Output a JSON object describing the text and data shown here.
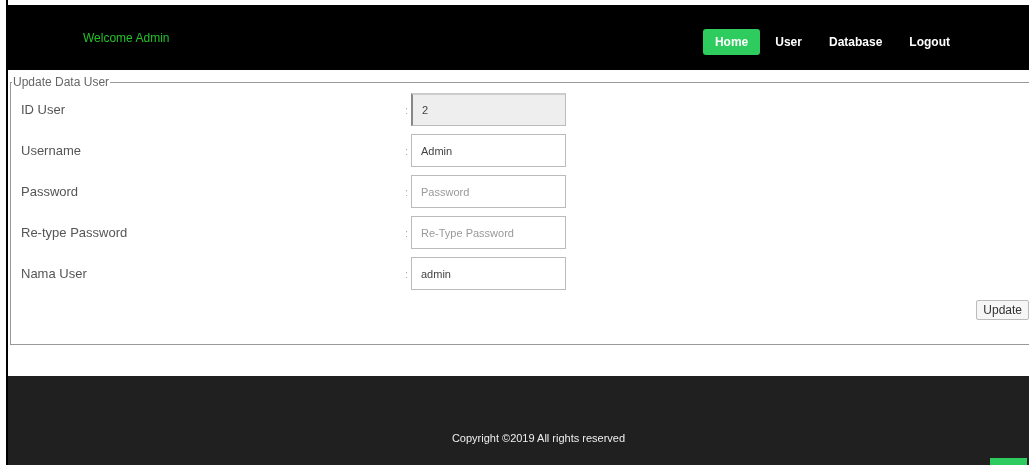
{
  "header": {
    "welcome": "Welcome Admin",
    "nav": [
      {
        "label": "Home",
        "selected": true
      },
      {
        "label": "User",
        "selected": false
      },
      {
        "label": "Database",
        "selected": false
      },
      {
        "label": "Logout",
        "selected": false
      }
    ]
  },
  "form": {
    "legend": "Update Data User",
    "fields": [
      {
        "label": "ID User",
        "separator": ":",
        "value": "2",
        "disabled": true
      },
      {
        "label": "Username",
        "separator": ":",
        "value": "Admin",
        "disabled": false
      },
      {
        "label": "Password",
        "separator": ":",
        "placeholder": "Password",
        "disabled": false
      },
      {
        "label": "Re-type Password",
        "separator": ":",
        "placeholder": "Re-Type Password",
        "disabled": false
      },
      {
        "label": "Nama User",
        "separator": ":",
        "value": "admin",
        "disabled": false
      }
    ],
    "submit": "Update"
  },
  "footer": {
    "copyright": "Copyright ©2019 All rights reserved"
  }
}
